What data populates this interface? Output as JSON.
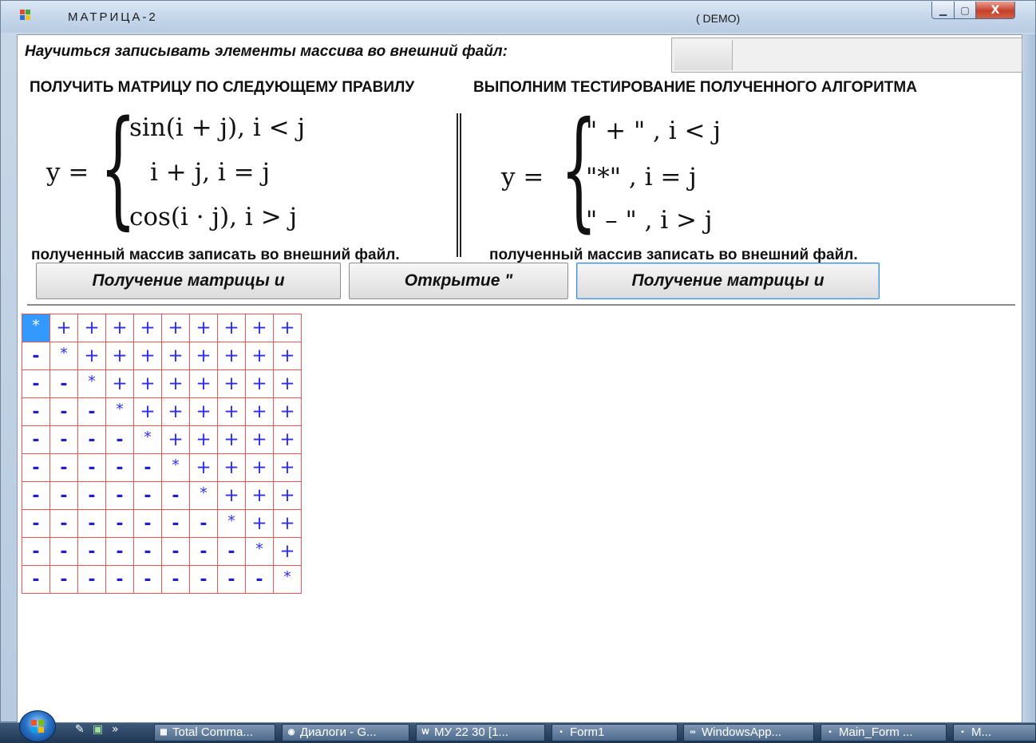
{
  "window": {
    "title": "МАТРИЦА-2",
    "demo_label": "( DEMO)",
    "minimize_glyph": "▁",
    "maximize_glyph": "▢",
    "close_glyph": "X"
  },
  "header": {
    "task_label": "Научиться записывать элементы массива во внешний файл:",
    "left_heading": "ПОЛУЧИТЬ МАТРИЦУ ПО СЛЕДУЮЩЕМУ ПРАВИЛУ",
    "right_heading": "ВЫПОЛНИМ ТЕСТИРОВАНИЕ ПОЛУЧЕННОГО АЛГОРИТМА"
  },
  "formula_left": {
    "lhs": "y =",
    "cases": [
      "sin(i + j), i < j",
      "i + j, i = j",
      "cos(i · j), i > j"
    ]
  },
  "formula_right": {
    "lhs": "y  =",
    "cases": [
      "\" + \" , i  <  j",
      "\"*\"  , i  =  j",
      "\" – \" , i  >  j"
    ]
  },
  "captions": {
    "left": "полученный массив записать во внешний файл.",
    "right": "полученный массив записать во внешний файл."
  },
  "buttons": {
    "get_matrix_left": "Получение матрицы и",
    "open": "Открытие \"",
    "get_matrix_right": "Получение матрицы и"
  },
  "grid": {
    "size": 10,
    "upper_symbol": "+",
    "diagonal_symbol": "*",
    "lower_symbol": "-",
    "selected_cell": [
      0,
      0
    ],
    "border_color": "#f05555",
    "text_color": "#2d2df0",
    "selected_color": "#3399ff"
  },
  "taskbar": {
    "quicklaunch_chevron": "»",
    "tasks": [
      {
        "icon": "total-commander-icon",
        "glyph": "▦",
        "label": "Total Comma..."
      },
      {
        "icon": "chrome-icon",
        "glyph": "◉",
        "label": "Диалоги - G..."
      },
      {
        "icon": "word-icon",
        "glyph": "W",
        "label": "МУ 22 30 [1..."
      },
      {
        "icon": "form-icon",
        "glyph": "▪",
        "label": "Form1"
      },
      {
        "icon": "visual-studio-icon",
        "glyph": "∞",
        "label": "WindowsApp..."
      },
      {
        "icon": "form-icon",
        "glyph": "▪",
        "label": "Main_Form ..."
      },
      {
        "icon": "form-icon",
        "glyph": "▪",
        "label": "М..."
      }
    ]
  }
}
